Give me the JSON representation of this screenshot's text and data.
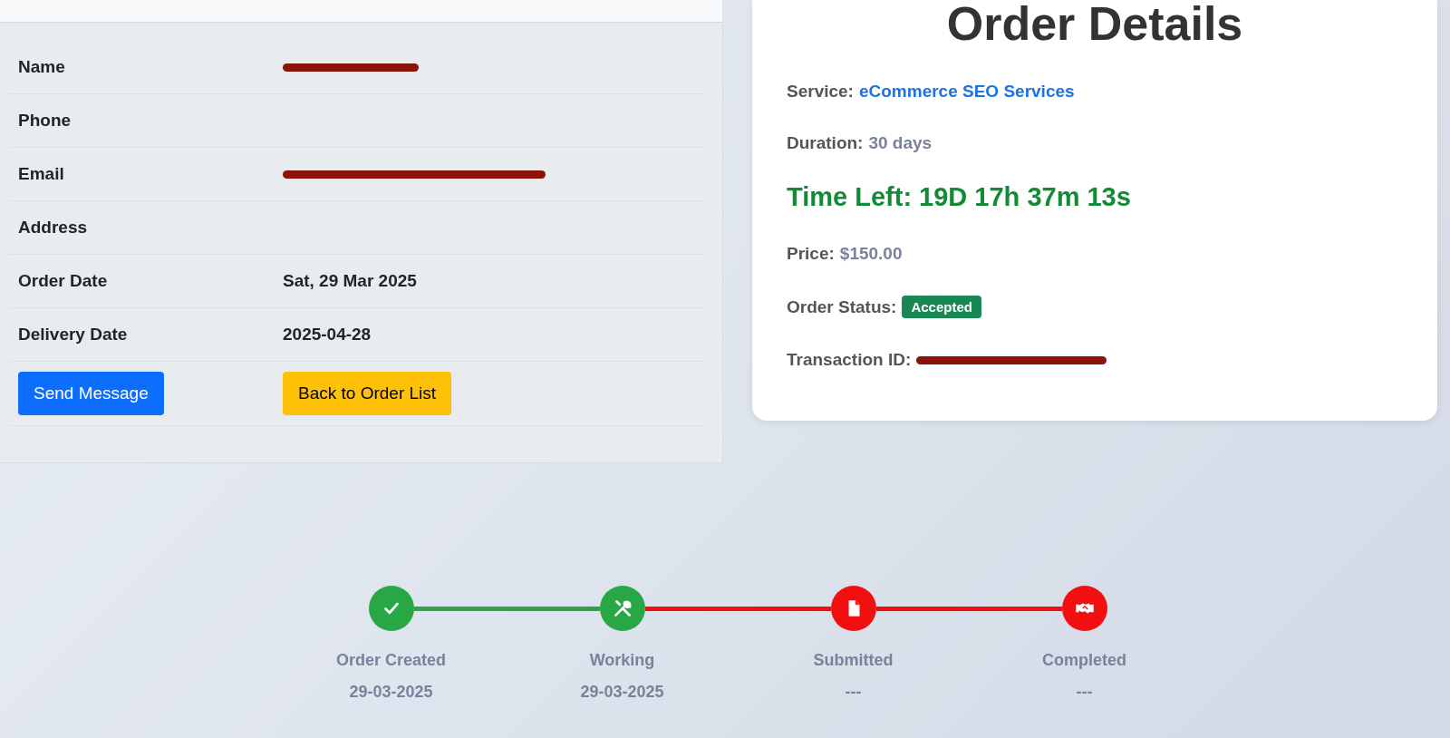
{
  "customer": {
    "rows": [
      {
        "label": "Name",
        "redacted": true
      },
      {
        "label": "Phone"
      },
      {
        "label": "Email",
        "redacted": true
      },
      {
        "label": "Address"
      },
      {
        "label": "Order Date",
        "value": "Sat, 29 Mar 2025"
      },
      {
        "label": "Delivery Date",
        "value": "2025-04-28"
      }
    ],
    "buttons": [
      {
        "label": "Send Message",
        "kind": "primary"
      },
      {
        "label": "Back to Order List",
        "kind": "warning"
      }
    ]
  },
  "order_details": {
    "title": "Order Details",
    "fields": [
      {
        "kind": "link",
        "label": "Service:",
        "value": "eCommerce SEO Services"
      },
      {
        "kind": "muted",
        "label": "Duration:",
        "value": "30 days"
      },
      {
        "kind": "timer",
        "text": "Time Left: 19D 17h 37m 13s"
      },
      {
        "kind": "muted",
        "label": "Price:",
        "value": "$150.00"
      },
      {
        "kind": "badge",
        "label": "Order Status:",
        "value": "Accepted"
      },
      {
        "kind": "redacted",
        "label": "Transaction ID:"
      }
    ]
  },
  "progress": [
    {
      "label": "Order Created",
      "date": "29-03-2025",
      "done": true
    },
    {
      "label": "Working",
      "date": "29-03-2025",
      "done": true
    },
    {
      "label": "Submitted",
      "date": "---",
      "done": false
    },
    {
      "label": "Completed",
      "date": "---",
      "done": false
    }
  ]
}
